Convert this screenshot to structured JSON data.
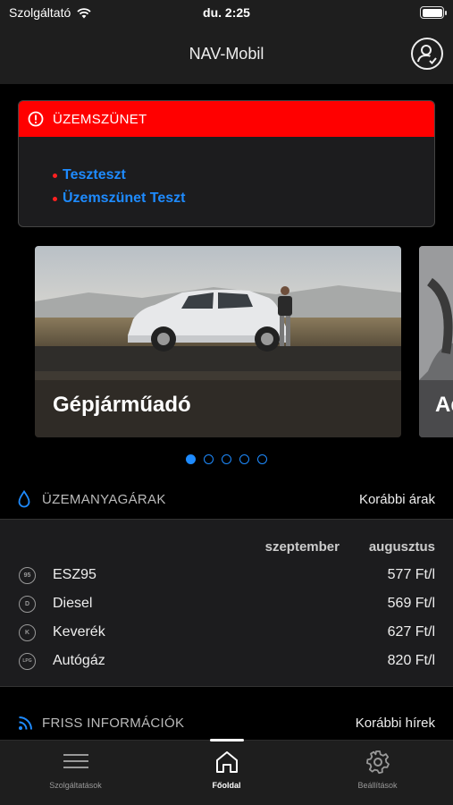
{
  "status_bar": {
    "carrier": "Szolgáltató",
    "time": "du. 2:25"
  },
  "header": {
    "title": "NAV-Mobil"
  },
  "outage": {
    "title": "ÜZEMSZÜNET",
    "items": [
      "Teszteszt",
      "Üzemszünet Teszt"
    ]
  },
  "carousel": {
    "slides": [
      "Gépjárműadó",
      "Ad"
    ],
    "dot_count": 5,
    "active_index": 0
  },
  "fuel": {
    "title": "ÜZEMANYAGÁRAK",
    "link": "Korábbi árak",
    "months": [
      "szeptember",
      "augusztus"
    ],
    "rows": [
      {
        "badge": "95",
        "name": "ESZ95",
        "price": "577 Ft/l"
      },
      {
        "badge": "D",
        "name": "Diesel",
        "price": "569 Ft/l"
      },
      {
        "badge": "K",
        "name": "Keverék",
        "price": "627 Ft/l"
      },
      {
        "badge": "LPG",
        "name": "Autógáz",
        "price": "820 Ft/l"
      }
    ]
  },
  "news": {
    "title": "FRISS INFORMÁCIÓK",
    "link": "Korábbi hírek"
  },
  "tabs": [
    "Szolgáltatások",
    "Főoldal",
    "Beállítások"
  ],
  "colors": {
    "accent": "#1e8bff",
    "alert": "#ff0000",
    "background": "#000000",
    "surface": "#1c1c1e"
  }
}
